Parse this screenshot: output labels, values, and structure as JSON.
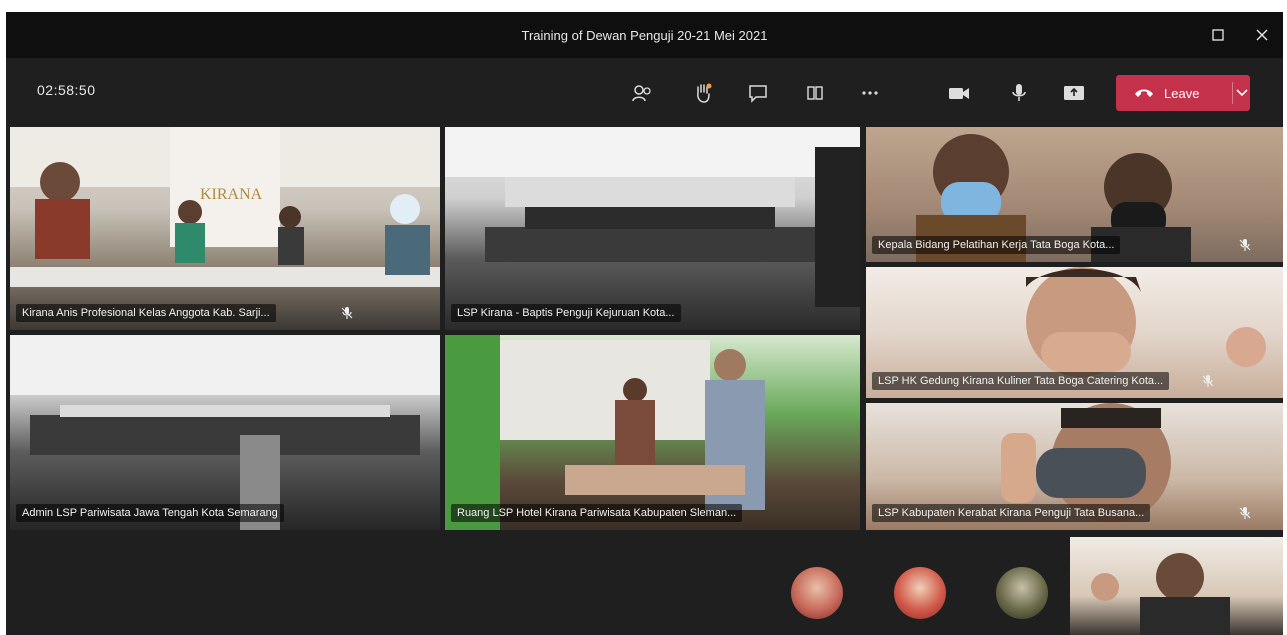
{
  "window": {
    "title": "Training of Dewan Penguji 20-21 Mei 2021"
  },
  "toolbar": {
    "timer": "02:58:50",
    "leave_label": "Leave",
    "icons": [
      "participants-icon",
      "raise-hand-icon",
      "chat-icon",
      "rooms-icon",
      "more-icon",
      "camera-icon",
      "microphone-icon",
      "share-screen-icon"
    ]
  },
  "tiles": [
    {
      "label": "Kirana Anis Profesional Kelas Anggota Kab. Sarji..."
    },
    {
      "label": "LSP Kirana - Baptis Penguji Kejuruan Kota..."
    },
    {
      "label": "Kepala Bidang Pelatihan Kerja Tata Boga Kota..."
    },
    {
      "label": "Admin LSP Pariwisata Jawa Tengah Kota Semarang"
    },
    {
      "label": "Ruang LSP Hotel Kirana Pariwisata Kabupaten Sleman..."
    },
    {
      "label": "LSP HK Gedung Kirana Kuliner Tata Boga Catering Kota..."
    },
    {
      "label": "LSP Kabupaten Kerabat Kirana Penguji Tata Busana..."
    }
  ],
  "avatars": [
    "participant-avatar-1",
    "participant-avatar-2",
    "participant-avatar-3"
  ],
  "colors": {
    "leave": "#c4314b",
    "background": "#1f1f1f",
    "titlebar": "#0f0f0f"
  }
}
